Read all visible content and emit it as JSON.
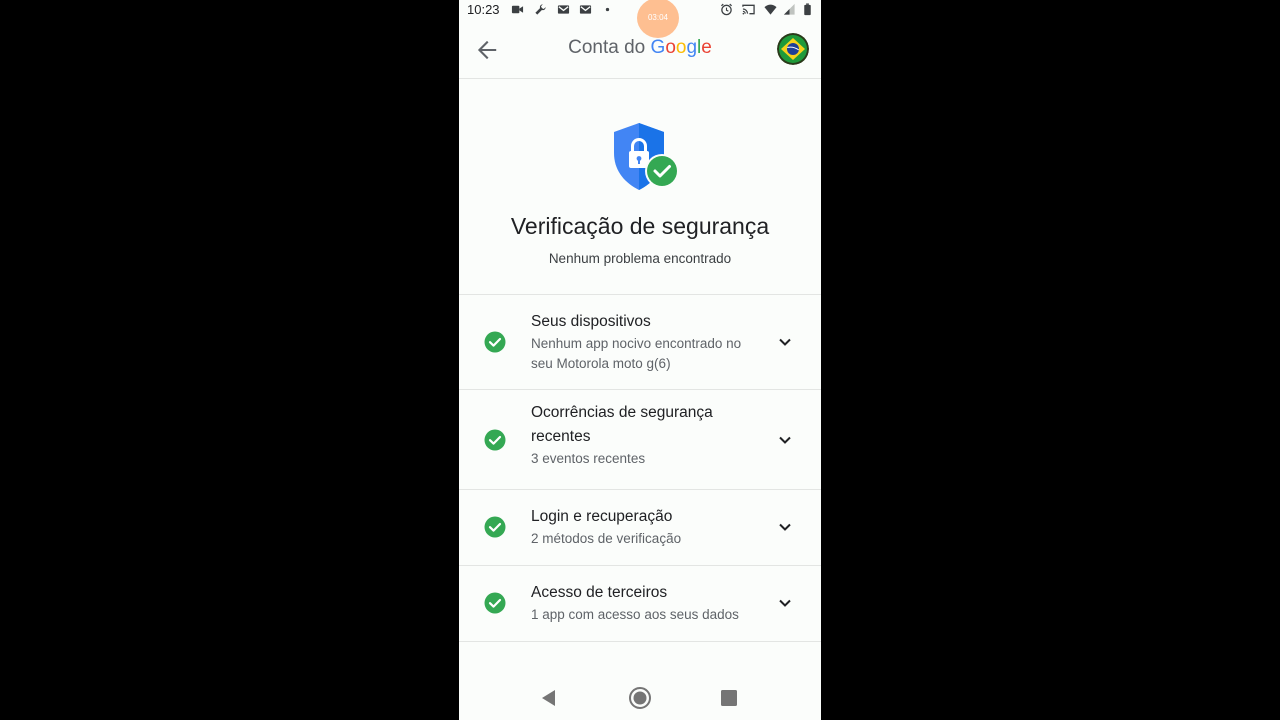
{
  "status_bar": {
    "time": "10:23",
    "recording_timer": "03:04",
    "left_icons": [
      "video-camera-icon",
      "wrench-icon",
      "gmail-icon",
      "gmail-icon",
      "dot-icon"
    ],
    "right_icons": [
      "alarm-icon",
      "cast-icon",
      "wifi-icon",
      "signal-icon",
      "battery-icon"
    ]
  },
  "app_bar": {
    "title_prefix": "Conta do",
    "brand": [
      "G",
      "o",
      "o",
      "g",
      "l",
      "e"
    ],
    "brand_colors": [
      "#4285F4",
      "#EA4335",
      "#FBBC05",
      "#4285F4",
      "#34A853",
      "#EA4335"
    ],
    "back_icon": "arrow-left-icon",
    "avatar": "brazil-flag-avatar"
  },
  "hero": {
    "icon": "shield-lock-check-icon",
    "title": "Verificação de segurança",
    "subtitle": "Nenhum problema encontrado"
  },
  "checks": [
    {
      "title": "Seus dispositivos",
      "desc_lines": [
        "Nenhum app nocivo encontrado no",
        "seu Motorola moto g(6)"
      ],
      "status": "ok"
    },
    {
      "title_lines": [
        "Ocorrências de segurança",
        "recentes"
      ],
      "desc": "3 eventos recentes",
      "status": "ok"
    },
    {
      "title": "Login e recuperação",
      "desc": "2 métodos de verificação",
      "status": "ok"
    },
    {
      "title": "Acesso de terceiros",
      "desc": "1 app com acesso aos seus dados",
      "status": "ok"
    }
  ],
  "colors": {
    "check_green": "#34A853",
    "shield_blue": "#4285F4",
    "text_primary": "#202124",
    "text_secondary": "#5f6368"
  },
  "nav_bar": {
    "icons": [
      "back-triangle-icon",
      "home-circle-icon",
      "recents-square-icon"
    ]
  }
}
